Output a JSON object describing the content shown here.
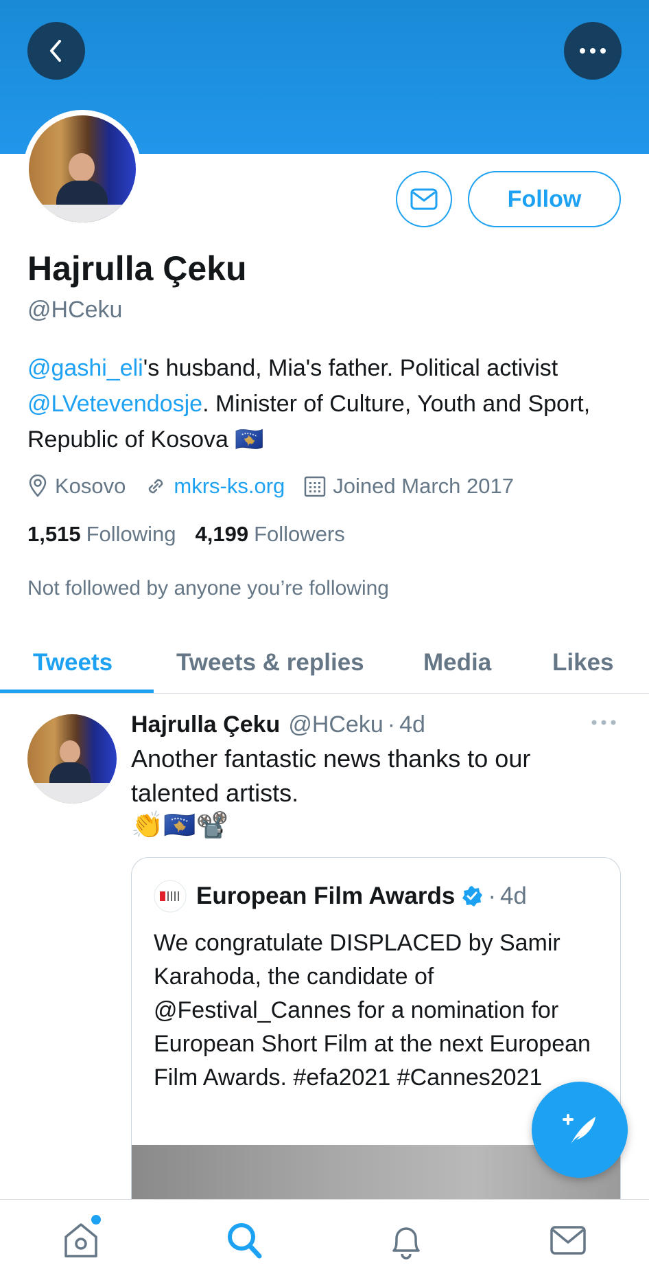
{
  "header": {
    "back_icon": "chevron-left-icon",
    "more_icon": "more-horizontal-icon",
    "banner_color": "#1a8ad6"
  },
  "profile": {
    "display_name": "Hajrulla Çeku",
    "handle": "@HCeku",
    "follow_label": "Follow",
    "bio": {
      "mention1": "@gashi_eli",
      "text1": "'s husband, Mia's father. Political activist ",
      "mention2": "@LVetevendosje",
      "text2": ". Minister of Culture, Youth and Sport, Republic of Kosova 🇽🇰"
    },
    "location": "Kosovo",
    "website": "mkrs-ks.org",
    "joined": "Joined March 2017",
    "following_count": "1,515",
    "following_label": "Following",
    "followers_count": "4,199",
    "followers_label": "Followers",
    "not_followed_text": "Not followed by anyone you’re following"
  },
  "tabs": [
    {
      "label": "Tweets",
      "active": true
    },
    {
      "label": "Tweets & replies",
      "active": false
    },
    {
      "label": "Media",
      "active": false
    },
    {
      "label": "Likes",
      "active": false
    }
  ],
  "tweet": {
    "author_name": "Hajrulla Çeku",
    "author_handle": "@HCeku",
    "separator": "·",
    "time": "4d",
    "text": "Another fantastic news thanks to our talented artists.",
    "emojis": "👏🇽🇰📽️",
    "quote": {
      "author_name": "European Film Awards",
      "separator": "·",
      "time": "4d",
      "text": "We congratulate DISPLACED by Samir Karahoda, the candidate of @Festival_Cannes for a nomination for European Short Film at the next European Film Awards. #efa2021 #Cannes2021"
    }
  },
  "bottom_nav": {
    "items": [
      "home-icon",
      "search-icon",
      "notifications-icon",
      "messages-icon"
    ],
    "active": "search-icon"
  },
  "colors": {
    "accent": "#1da1f2",
    "text_primary": "#14171a",
    "text_secondary": "#657786"
  }
}
